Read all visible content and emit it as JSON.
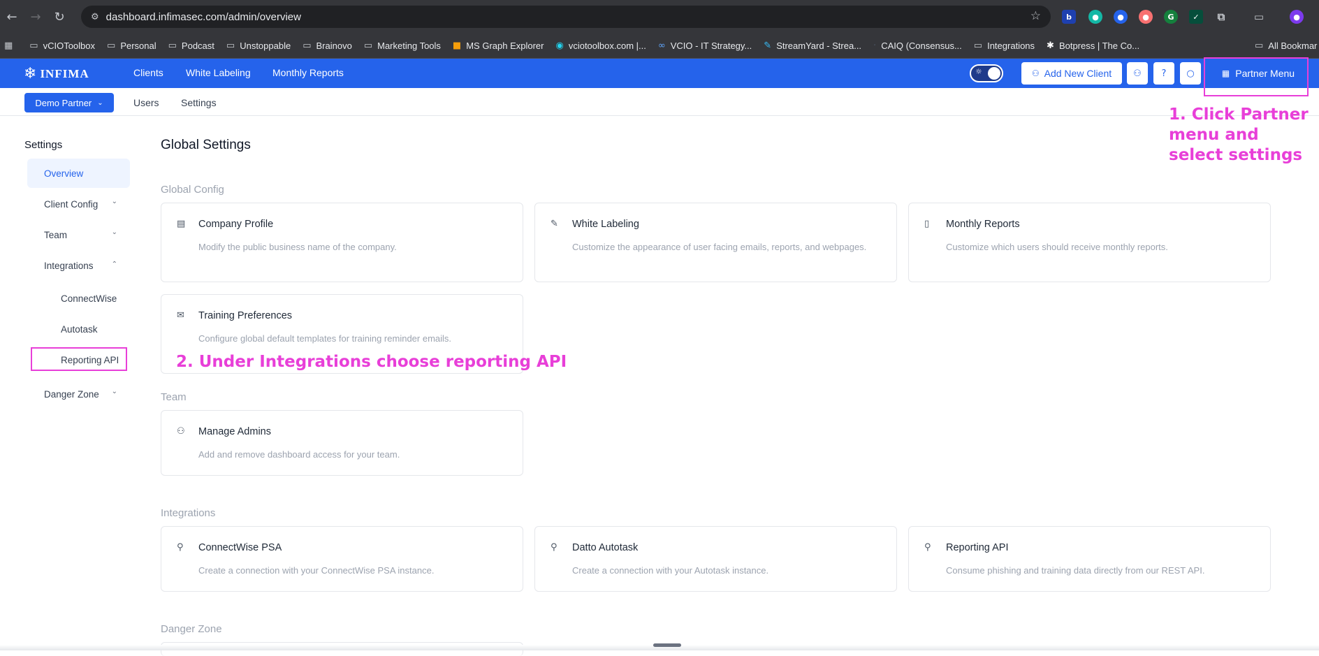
{
  "browser": {
    "url": "dashboard.infimasec.com/admin/overview",
    "bookmarks": [
      "vCIOToolbox",
      "Personal",
      "Podcast",
      "Unstoppable",
      "Brainovo",
      "Marketing Tools",
      "MS Graph Explorer",
      "vciotoolbox.com |...",
      "VCIO - IT Strategy...",
      "StreamYard - Strea...",
      "CAIQ (Consensus...",
      "Integrations",
      "Botpress | The Co...",
      "All Bookmar"
    ]
  },
  "app": {
    "logo": "INFIMA",
    "nav": [
      "Clients",
      "White Labeling",
      "Monthly Reports"
    ],
    "add_client": "Add New Client",
    "partner_menu": "Partner Menu",
    "partner_selector": "Demo Partner",
    "subnav": [
      "Users",
      "Settings"
    ]
  },
  "sidebar": {
    "title": "Settings",
    "items": [
      "Overview",
      "Client Config",
      "Team",
      "Integrations",
      "ConnectWise",
      "Autotask",
      "Reporting API",
      "Danger Zone"
    ]
  },
  "main": {
    "title": "Global Settings",
    "sections": {
      "global_config": "Global Config",
      "team": "Team",
      "integrations": "Integrations",
      "danger": "Danger Zone"
    },
    "cards": {
      "company": {
        "title": "Company Profile",
        "desc": "Modify the public business name of the company."
      },
      "white": {
        "title": "White Labeling",
        "desc": "Customize the appearance of user facing emails, reports, and webpages."
      },
      "monthly": {
        "title": "Monthly Reports",
        "desc": "Customize which users should receive monthly reports."
      },
      "training": {
        "title": "Training Preferences",
        "desc": "Configure global default templates for training reminder emails."
      },
      "admins": {
        "title": "Manage Admins",
        "desc": "Add and remove dashboard access for your team."
      },
      "cw": {
        "title": "ConnectWise PSA",
        "desc": "Create a connection with your ConnectWise PSA instance."
      },
      "datto": {
        "title": "Datto Autotask",
        "desc": "Create a connection with your Autotask instance."
      },
      "api": {
        "title": "Reporting API",
        "desc": "Consume phishing and training data directly from our REST API."
      }
    }
  },
  "annotations": {
    "step1": "1. Click Partner menu and select settings",
    "step2": "2. Under Integrations choose reporting API"
  },
  "colors": {
    "brand": "#2563eb",
    "annotation": "#e83fd8"
  }
}
